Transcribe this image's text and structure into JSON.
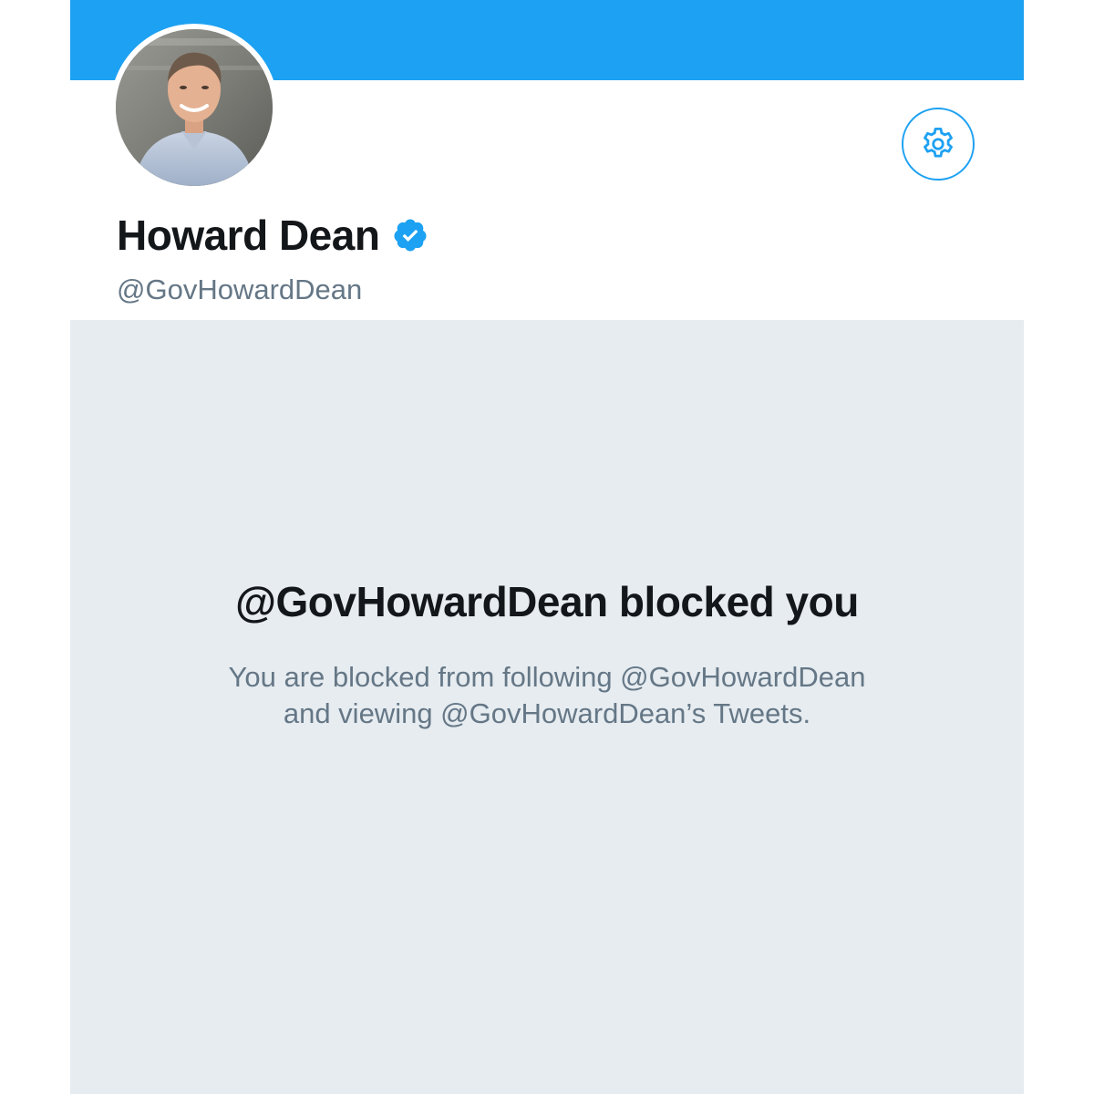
{
  "profile": {
    "display_name": "Howard Dean",
    "handle": "@GovHowardDean",
    "verified": true
  },
  "icons": {
    "settings": "gear-icon",
    "verified": "verified-badge-icon",
    "avatar": "profile-photo"
  },
  "blocked": {
    "title": "@GovHowardDean blocked you",
    "line1": "You are blocked from following @GovHowardDean",
    "line2": "and viewing @GovHowardDean’s Tweets."
  },
  "colors": {
    "brand": "#1da1f2",
    "panel_background": "#e6ecf0",
    "primary_text": "#14171a",
    "secondary_text": "#657786"
  }
}
